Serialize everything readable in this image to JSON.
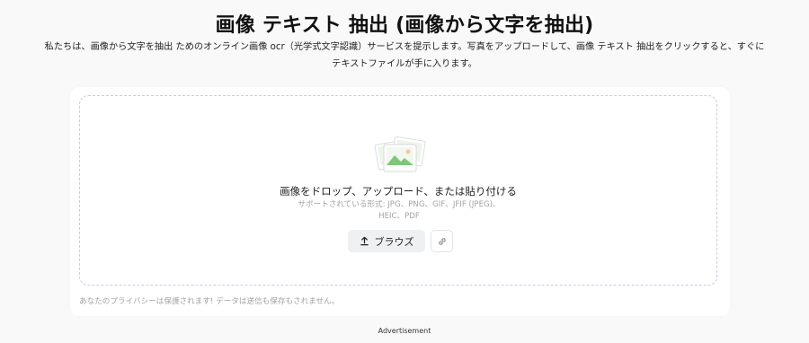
{
  "header": {
    "title": "画像 テキスト 抽出 (画像から文字を抽出)",
    "description_line1": "私たちは、画像から文字を抽出 ためのオンライン画像 ocr（光学式文字認識）サービスを提示します。写真をアップロードして、画像 テキスト 抽出をクリックすると、すぐに",
    "description_line2": "テキストファイルが手に入ります。"
  },
  "upload": {
    "drop_text": "画像をドロップ、アップロード、または貼り付ける",
    "formats_line1": "サポートされている形式: JPG、PNG、GIF、JFIF (JPEG)、",
    "formats_line2": "HEIC、PDF",
    "browse_label": "ブラウズ",
    "browse_icon": "upload-icon",
    "link_icon": "link-icon",
    "illustration_icon": "image-stack-icon",
    "privacy_note": "あなたのプライバシーは保護されます! データは送信も保存もされません。"
  },
  "footer": {
    "ad_label": "Advertisement"
  },
  "colors": {
    "background": "#f9f9fa",
    "card": "#ffffff",
    "dashed_border": "#c9cbe8",
    "muted_text": "#a3a3a8",
    "illustration_green": "#7ec77a"
  }
}
